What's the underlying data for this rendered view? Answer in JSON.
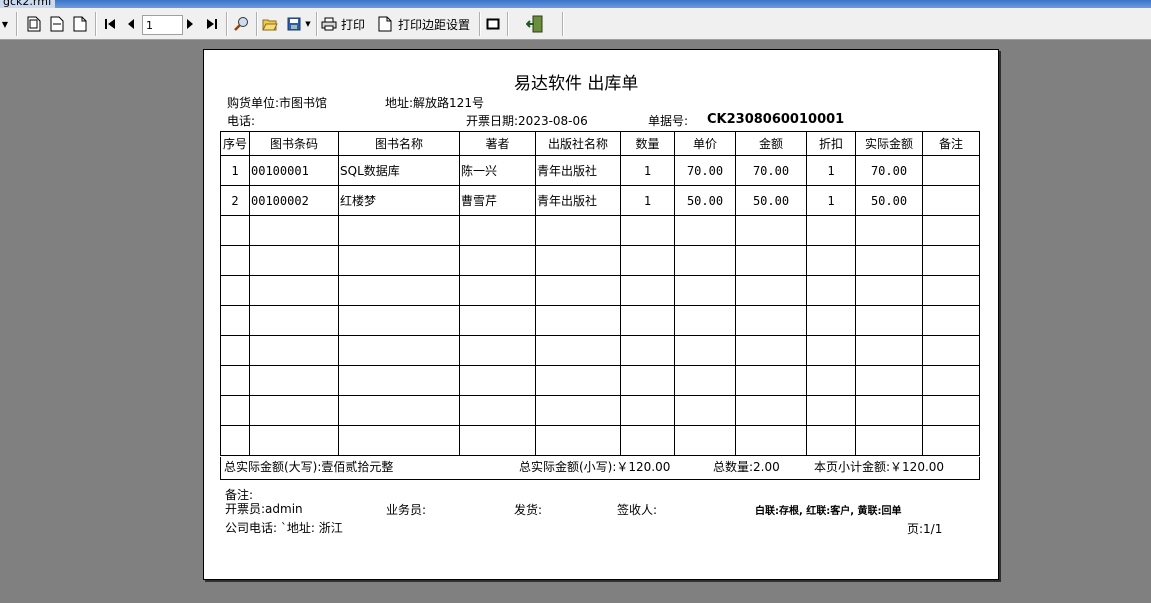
{
  "window": {
    "title": "gck2.rmf"
  },
  "toolbar": {
    "page_value": "1",
    "print_label": "打印",
    "margin_label": "打印边距设置"
  },
  "report": {
    "title": "易达软件 出库单",
    "buyer": "购货单位:市图书馆",
    "address": "地址:解放路121号",
    "phone": "电话:",
    "date": "开票日期:2023-08-06",
    "doc_no_label": "单据号:",
    "doc_no": "CK2308060010001",
    "columns": [
      "序号",
      "图书条码",
      "图书名称",
      "著者",
      "出版社名称",
      "数量",
      "单价",
      "金额",
      "折扣",
      "实际金额",
      "备注"
    ],
    "rows": [
      [
        "1",
        "00100001",
        "SQL数据库",
        "陈一兴",
        "青年出版社",
        "1",
        "70.00",
        "70.00",
        "1",
        "70.00",
        ""
      ],
      [
        "2",
        "00100002",
        "红楼梦",
        "曹雪芹",
        "青年出版社",
        "1",
        "50.00",
        "50.00",
        "1",
        "50.00",
        ""
      ]
    ],
    "total_upper": "总实际金额(大写):壹佰贰拾元整",
    "total_lower": "总实际金额(小写):￥120.00",
    "total_qty": "总数量:2.00",
    "page_subtotal": "本页小计金额:￥120.00",
    "remark": "备注:",
    "issuer": "开票员:admin",
    "salesman": "业务员:",
    "shipping": "发货:",
    "receiver": "签收人:",
    "copies_note": "白联:存根, 红联:客户, 黄联:回单",
    "company_phone": "公司电话: ˋ地址: 浙江",
    "page_no": "页:1/1"
  }
}
